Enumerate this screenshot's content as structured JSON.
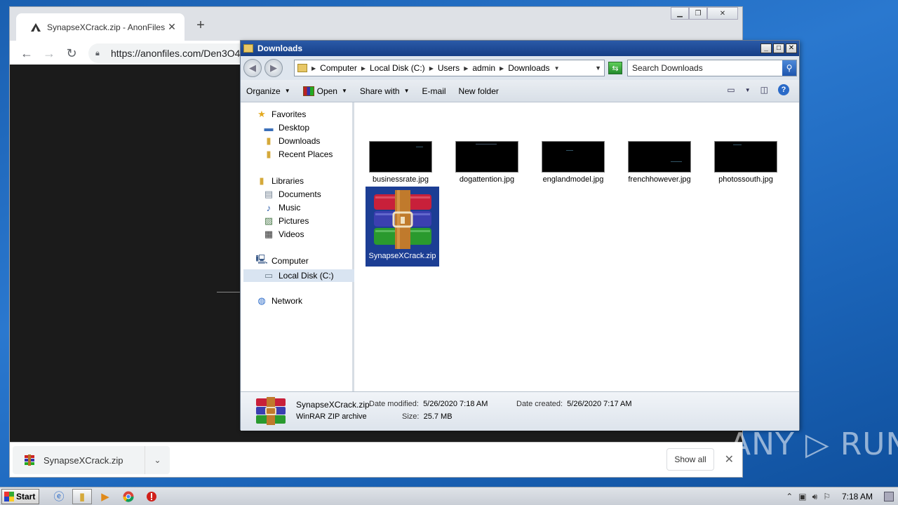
{
  "chrome": {
    "tab_title": "SynapseXCrack.zip - AnonFiles",
    "url": "https://anonfiles.com/Den3O4",
    "download_name": "SynapseXCrack.zip",
    "show_all_label": "Show all"
  },
  "explorer": {
    "window_title": "Downloads",
    "breadcrumb": [
      "Computer",
      "Local Disk (C:)",
      "Users",
      "admin",
      "Downloads"
    ],
    "search_placeholder": "Search Downloads",
    "commands": {
      "organize": "Organize",
      "open": "Open",
      "share_with": "Share with",
      "email": "E-mail",
      "new_folder": "New folder"
    },
    "nav": {
      "favorites": "Favorites",
      "desktop": "Desktop",
      "downloads": "Downloads",
      "recent_places": "Recent Places",
      "libraries": "Libraries",
      "documents": "Documents",
      "music": "Music",
      "pictures": "Pictures",
      "videos": "Videos",
      "computer": "Computer",
      "local_disk": "Local Disk (C:)",
      "network": "Network"
    },
    "files": [
      {
        "name": "businessrate.jpg"
      },
      {
        "name": "dogattention.jpg"
      },
      {
        "name": "englandmodel.jpg"
      },
      {
        "name": "frenchhowever.jpg"
      },
      {
        "name": "photossouth.jpg"
      },
      {
        "name": "SynapseXCrack.zip"
      }
    ],
    "details": {
      "name": "SynapseXCrack.zip",
      "type": "WinRAR ZIP archive",
      "modified_label": "Date modified:",
      "modified_value": "5/26/2020 7:18 AM",
      "created_label": "Date created:",
      "created_value": "5/26/2020 7:17 AM",
      "size_label": "Size:",
      "size_value": "25.7 MB"
    }
  },
  "taskbar": {
    "start_label": "Start",
    "clock": "7:18 AM"
  },
  "watermark": "ANY ▷ RUN",
  "colors": {
    "desktop": "#1f6bc4",
    "explorer_title": "#1e4a96",
    "selection": "#1c3e94"
  }
}
